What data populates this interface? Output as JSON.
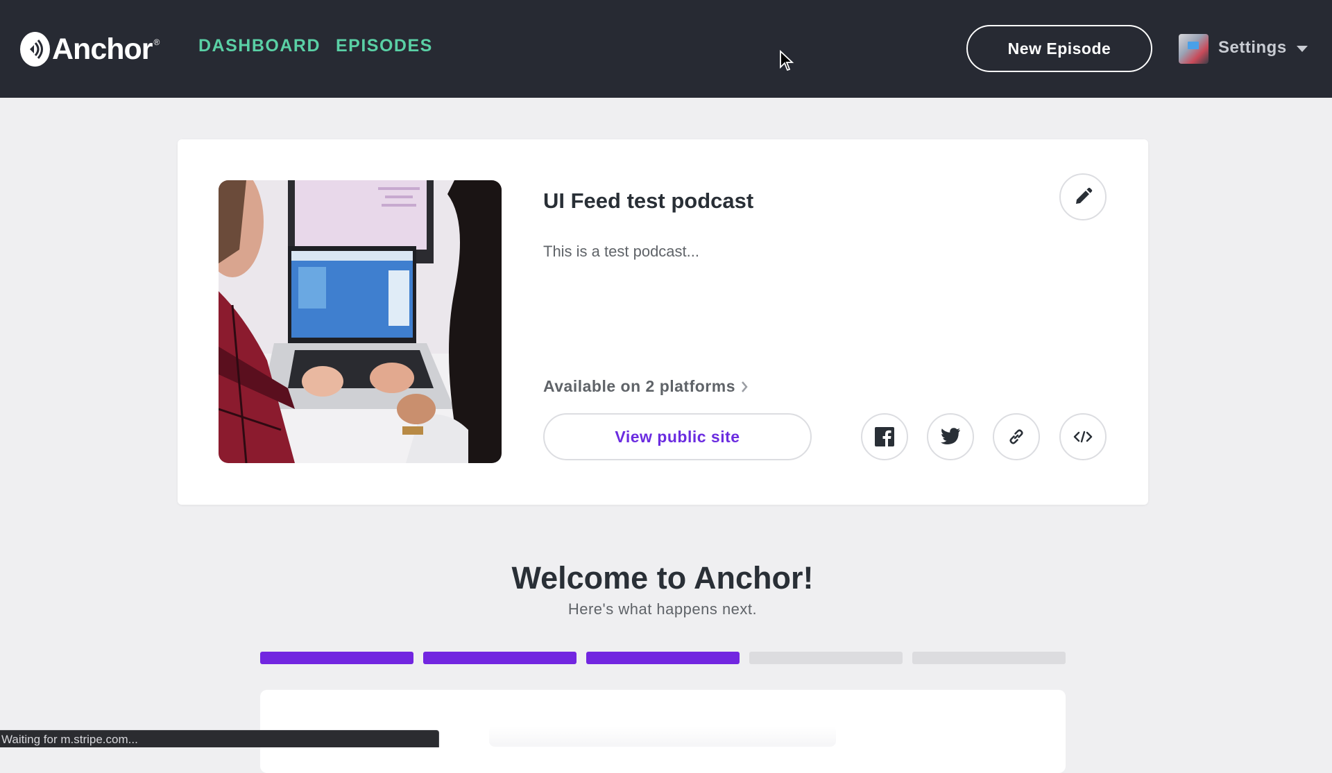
{
  "header": {
    "logo_text": "Anchor",
    "logo_registered": "®",
    "nav": {
      "dashboard": "DASHBOARD",
      "episodes": "EPISODES"
    },
    "new_episode_label": "New Episode",
    "settings_label": "Settings",
    "accent_color": "#5ad0a5"
  },
  "podcast": {
    "title": "UI Feed test podcast",
    "description": "This is a test podcast...",
    "platforms_text": "Available on 2 platforms",
    "view_site_label": "View public site",
    "share_icons": [
      "facebook-icon",
      "twitter-icon",
      "link-icon",
      "embed-icon"
    ]
  },
  "welcome": {
    "title": "Welcome to Anchor!",
    "subtitle": "Here's what happens next.",
    "progress": {
      "completed_steps": 3,
      "total_steps": 5
    },
    "progress_color": "#7226e0"
  },
  "status_bar": {
    "text": "Waiting for m.stripe.com..."
  }
}
